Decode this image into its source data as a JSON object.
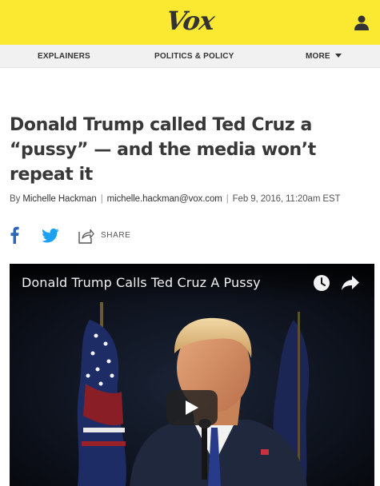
{
  "brand": {
    "logo_text": "Vox",
    "color_bar": "#fae930"
  },
  "nav": {
    "explainers": "EXPLAINERS",
    "politics": "POLITICS & POLICY",
    "more": "MORE"
  },
  "article": {
    "headline": "Donald Trump called Ted Cruz a “pussy” — and the media won’t repeat it",
    "byline_prefix": "By",
    "author": "Michelle Hackman",
    "email": "michelle.hackman@vox.com",
    "date": "Feb 9, 2016, 11:20am EST"
  },
  "share": {
    "label": "SHARE",
    "facebook_icon": "facebook-icon",
    "twitter_icon": "twitter-icon"
  },
  "video": {
    "title": "Donald Trump Calls Ted Cruz A Pussy",
    "watch_later_icon": "clock-icon",
    "share_icon": "share-arrow-icon",
    "play_icon": "play-icon"
  }
}
